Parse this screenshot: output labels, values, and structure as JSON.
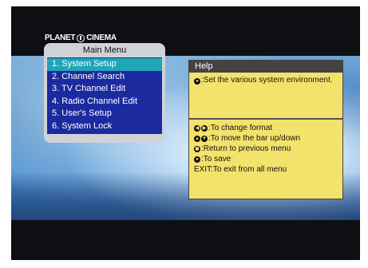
{
  "brand": {
    "logo_left": "PLANET",
    "logo_right": "CINEMA"
  },
  "menu": {
    "title": "Main Menu",
    "items": [
      {
        "label": "1. System Setup",
        "active": true
      },
      {
        "label": "2. Channel Search"
      },
      {
        "label": "3. TV Channel Edit"
      },
      {
        "label": "4. Radio Channel Edit"
      },
      {
        "label": "5. User's Setup"
      },
      {
        "label": "6. System Lock"
      }
    ]
  },
  "help": {
    "header": "Help",
    "description": ":Set the various system environment.",
    "keys": [
      {
        "icons": [
          "◀",
          "▶"
        ],
        "text": ":To change format"
      },
      {
        "icons": [
          "▲",
          "▼"
        ],
        "text": ":To move the bar up/down"
      },
      {
        "icons": [
          "◼"
        ],
        "text": ":Return to previous menu"
      },
      {
        "icons": [
          "●"
        ],
        "text": ":To save"
      },
      {
        "icons": [],
        "text": "EXIT:To exit from all menu"
      }
    ]
  },
  "colors": {
    "menu_bg": "#1c2aa0",
    "menu_active": "#1fa6b6",
    "help_bg": "#f3e26b",
    "help_header": "#434343"
  }
}
